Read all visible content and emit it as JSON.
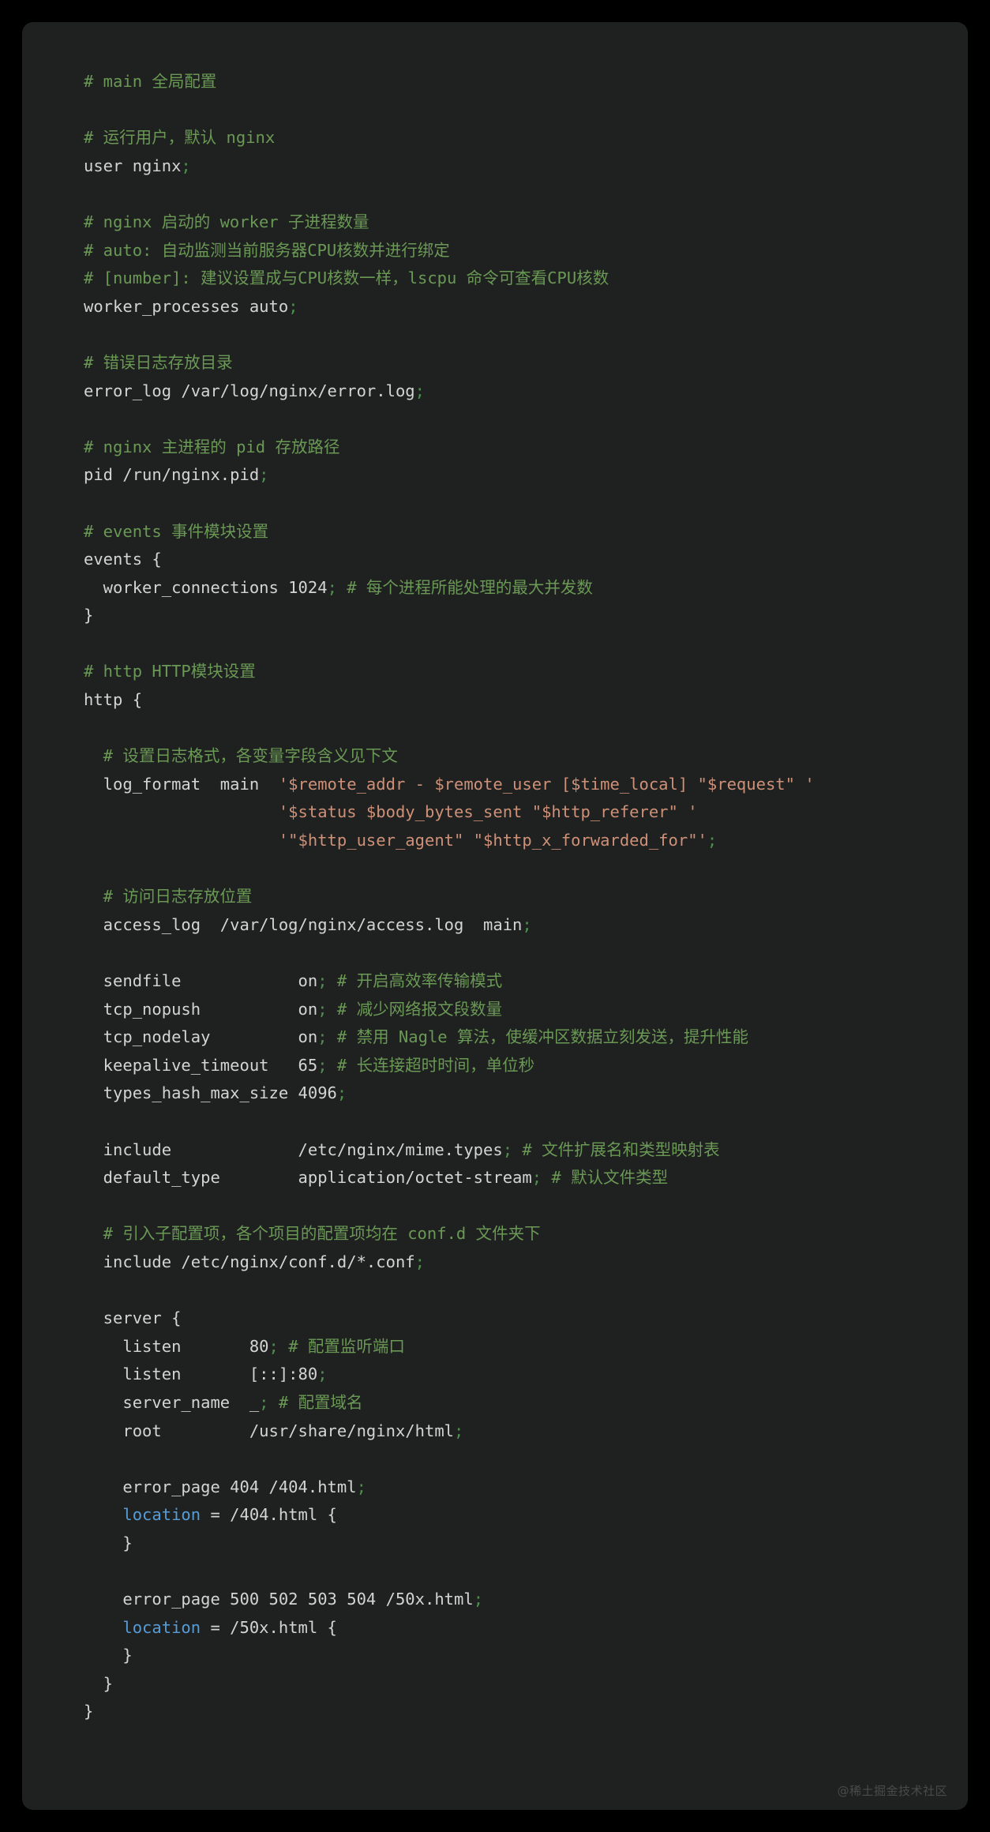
{
  "theme": {
    "page_background": "#000000",
    "card_background": "#1f2020",
    "plain_color": "#d4d4d4",
    "comment_color": "#6a9955",
    "string_color": "#ce9178",
    "keyword_color": "#569cd6",
    "punctuation_color": "#4e8f4e",
    "watermark_color": "#4a4a4a"
  },
  "watermark": "@稀土掘金技术社区",
  "code": {
    "language": "nginx",
    "filename": "nginx.conf",
    "lines": [
      [
        {
          "t": "# main 全局配置",
          "c": "cm"
        }
      ],
      [],
      [
        {
          "t": "# 运行用户，默认 nginx",
          "c": "cm"
        }
      ],
      [
        {
          "t": "user nginx",
          "c": "pl"
        },
        {
          "t": ";",
          "c": "sc"
        }
      ],
      [],
      [
        {
          "t": "# nginx 启动的 worker 子进程数量",
          "c": "cm"
        }
      ],
      [
        {
          "t": "# auto: 自动监测当前服务器CPU核数并进行绑定",
          "c": "cm"
        }
      ],
      [
        {
          "t": "# [number]: 建议设置成与CPU核数一样，lscpu 命令可查看CPU核数",
          "c": "cm"
        }
      ],
      [
        {
          "t": "worker_processes auto",
          "c": "pl"
        },
        {
          "t": ";",
          "c": "sc"
        }
      ],
      [],
      [
        {
          "t": "# 错误日志存放目录",
          "c": "cm"
        }
      ],
      [
        {
          "t": "error_log /var/log/nginx/error.log",
          "c": "pl"
        },
        {
          "t": ";",
          "c": "sc"
        }
      ],
      [],
      [
        {
          "t": "# nginx 主进程的 pid 存放路径",
          "c": "cm"
        }
      ],
      [
        {
          "t": "pid /run/nginx.pid",
          "c": "pl"
        },
        {
          "t": ";",
          "c": "sc"
        }
      ],
      [],
      [
        {
          "t": "# events 事件模块设置",
          "c": "cm"
        }
      ],
      [
        {
          "t": "events {",
          "c": "pl"
        }
      ],
      [
        {
          "t": "  worker_connections 1024",
          "c": "pl"
        },
        {
          "t": ";",
          "c": "sc"
        },
        {
          "t": " ",
          "c": "pl"
        },
        {
          "t": "# 每个进程所能处理的最大并发数",
          "c": "cm"
        }
      ],
      [
        {
          "t": "}",
          "c": "pl"
        }
      ],
      [],
      [
        {
          "t": "# http HTTP模块设置",
          "c": "cm"
        }
      ],
      [
        {
          "t": "http {",
          "c": "pl"
        }
      ],
      [],
      [
        {
          "t": "  # 设置日志格式，各变量字段含义见下文",
          "c": "cm"
        }
      ],
      [
        {
          "t": "  log_format  main  ",
          "c": "pl"
        },
        {
          "t": "'$remote_addr - $remote_user [$time_local] \"$request\" '",
          "c": "st"
        }
      ],
      [
        {
          "t": "                    ",
          "c": "pl"
        },
        {
          "t": "'$status $body_bytes_sent \"$http_referer\" '",
          "c": "st"
        }
      ],
      [
        {
          "t": "                    ",
          "c": "pl"
        },
        {
          "t": "'\"$http_user_agent\" \"$http_x_forwarded_for\"'",
          "c": "st"
        },
        {
          "t": ";",
          "c": "sc"
        }
      ],
      [],
      [
        {
          "t": "  # 访问日志存放位置",
          "c": "cm"
        }
      ],
      [
        {
          "t": "  access_log  /var/log/nginx/access.log  main",
          "c": "pl"
        },
        {
          "t": ";",
          "c": "sc"
        }
      ],
      [],
      [
        {
          "t": "  sendfile            on",
          "c": "pl"
        },
        {
          "t": ";",
          "c": "sc"
        },
        {
          "t": " ",
          "c": "pl"
        },
        {
          "t": "# 开启高效率传输模式",
          "c": "cm"
        }
      ],
      [
        {
          "t": "  tcp_nopush          on",
          "c": "pl"
        },
        {
          "t": ";",
          "c": "sc"
        },
        {
          "t": " ",
          "c": "pl"
        },
        {
          "t": "# 减少网络报文段数量",
          "c": "cm"
        }
      ],
      [
        {
          "t": "  tcp_nodelay         on",
          "c": "pl"
        },
        {
          "t": ";",
          "c": "sc"
        },
        {
          "t": " ",
          "c": "pl"
        },
        {
          "t": "# 禁用 Nagle 算法，使缓冲区数据立刻发送，提升性能",
          "c": "cm"
        }
      ],
      [
        {
          "t": "  keepalive_timeout   65",
          "c": "pl"
        },
        {
          "t": ";",
          "c": "sc"
        },
        {
          "t": " ",
          "c": "pl"
        },
        {
          "t": "# 长连接超时时间，单位秒",
          "c": "cm"
        }
      ],
      [
        {
          "t": "  types_hash_max_size 4096",
          "c": "pl"
        },
        {
          "t": ";",
          "c": "sc"
        }
      ],
      [],
      [
        {
          "t": "  include             /etc/nginx/mime.types",
          "c": "pl"
        },
        {
          "t": ";",
          "c": "sc"
        },
        {
          "t": " ",
          "c": "pl"
        },
        {
          "t": "# 文件扩展名和类型映射表",
          "c": "cm"
        }
      ],
      [
        {
          "t": "  default_type        application/octet-stream",
          "c": "pl"
        },
        {
          "t": ";",
          "c": "sc"
        },
        {
          "t": " ",
          "c": "pl"
        },
        {
          "t": "# 默认文件类型",
          "c": "cm"
        }
      ],
      [],
      [
        {
          "t": "  # 引入子配置项，各个项目的配置项均在 conf.d 文件夹下",
          "c": "cm"
        }
      ],
      [
        {
          "t": "  include /etc/nginx/conf.d/*.conf",
          "c": "pl"
        },
        {
          "t": ";",
          "c": "sc"
        }
      ],
      [],
      [
        {
          "t": "  server {",
          "c": "pl"
        }
      ],
      [
        {
          "t": "    listen       80",
          "c": "pl"
        },
        {
          "t": ";",
          "c": "sc"
        },
        {
          "t": " ",
          "c": "pl"
        },
        {
          "t": "# 配置监听端口",
          "c": "cm"
        }
      ],
      [
        {
          "t": "    listen       [::]:80",
          "c": "pl"
        },
        {
          "t": ";",
          "c": "sc"
        }
      ],
      [
        {
          "t": "    server_name  _",
          "c": "pl"
        },
        {
          "t": ";",
          "c": "sc"
        },
        {
          "t": " ",
          "c": "pl"
        },
        {
          "t": "# 配置域名",
          "c": "cm"
        }
      ],
      [
        {
          "t": "    root         /usr/share/nginx/html",
          "c": "pl"
        },
        {
          "t": ";",
          "c": "sc"
        }
      ],
      [],
      [
        {
          "t": "    error_page 404 /404.html",
          "c": "pl"
        },
        {
          "t": ";",
          "c": "sc"
        }
      ],
      [
        {
          "t": "    location",
          "c": "kw"
        },
        {
          "t": " = /404.html {",
          "c": "pl"
        }
      ],
      [
        {
          "t": "    }",
          "c": "pl"
        }
      ],
      [],
      [
        {
          "t": "    error_page 500 502 503 504 /50x.html",
          "c": "pl"
        },
        {
          "t": ";",
          "c": "sc"
        }
      ],
      [
        {
          "t": "    location",
          "c": "kw"
        },
        {
          "t": " = /50x.html {",
          "c": "pl"
        }
      ],
      [
        {
          "t": "    }",
          "c": "pl"
        }
      ],
      [
        {
          "t": "  }",
          "c": "pl"
        }
      ],
      [
        {
          "t": "}",
          "c": "pl"
        }
      ]
    ]
  }
}
